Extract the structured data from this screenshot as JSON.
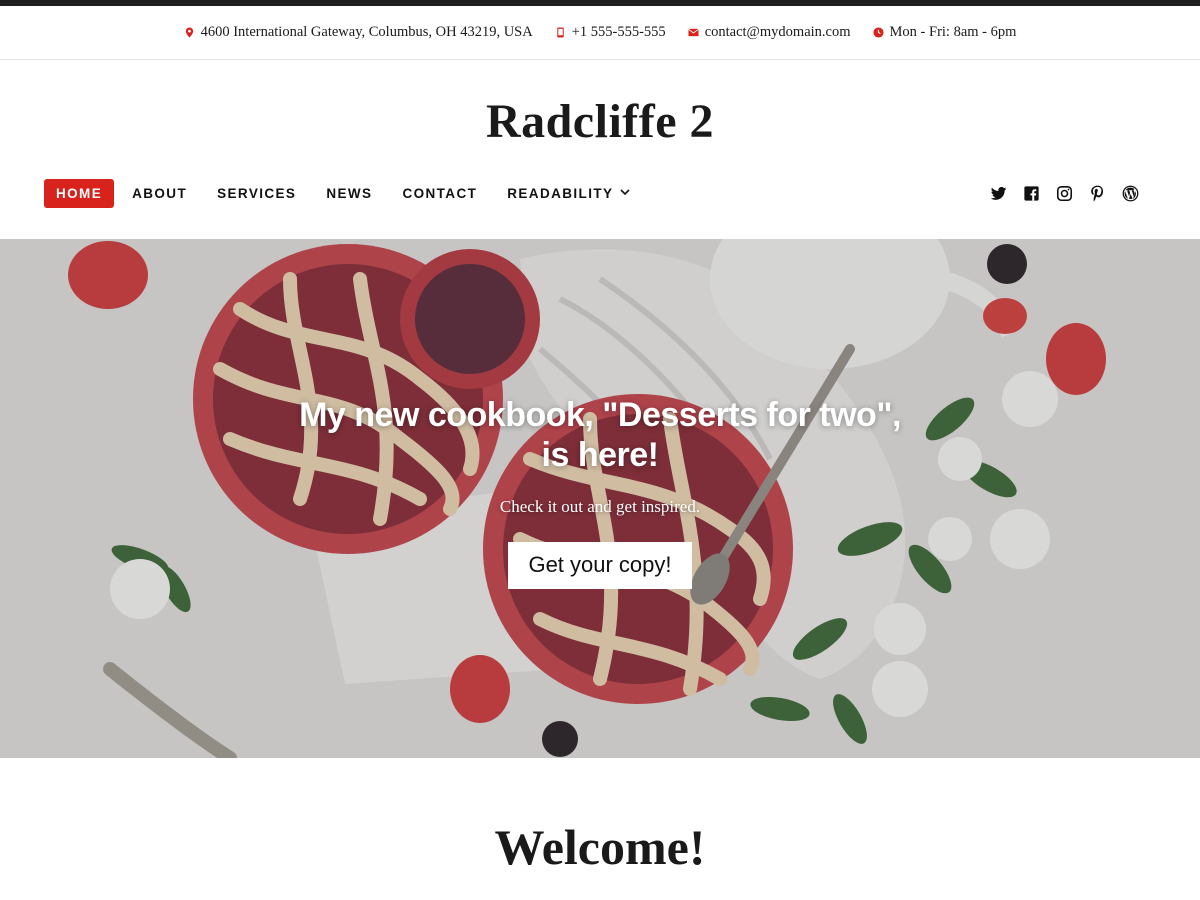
{
  "colors": {
    "accent": "#d8221c",
    "text": "#111111",
    "topStrip": "#1f1f1f"
  },
  "infobar": {
    "address": {
      "icon": "map-pin-icon",
      "text": "4600 International Gateway, Columbus, OH 43219, USA"
    },
    "phone": {
      "icon": "phone-icon",
      "text": "+1 555-555-555"
    },
    "email": {
      "icon": "envelope-icon",
      "text": "contact@mydomain.com"
    },
    "hours": {
      "icon": "clock-icon",
      "text": "Mon - Fri: 8am - 6pm"
    }
  },
  "site": {
    "title": "Radcliffe 2"
  },
  "nav": {
    "items": [
      {
        "label": "HOME",
        "active": true
      },
      {
        "label": "ABOUT"
      },
      {
        "label": "SERVICES"
      },
      {
        "label": "NEWS"
      },
      {
        "label": "CONTACT"
      },
      {
        "label": "READABILITY",
        "dropdown": true
      }
    ],
    "social": [
      "twitter-icon",
      "facebook-icon",
      "instagram-icon",
      "pinterest-icon",
      "wordpress-icon"
    ]
  },
  "hero": {
    "title": "My new cookbook, \"Desserts for two\", is here!",
    "subtitle": "Check it out and get inspired.",
    "button": "Get your copy!"
  },
  "welcome": {
    "heading": "Welcome!"
  }
}
